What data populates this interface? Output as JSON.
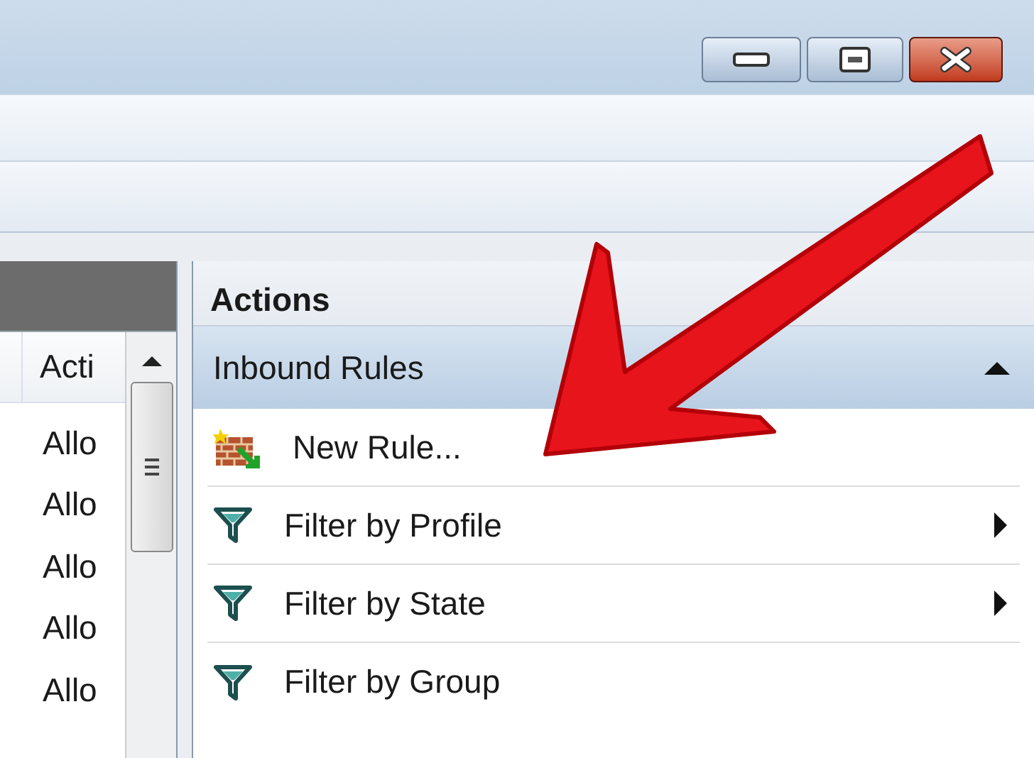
{
  "left_pane": {
    "columns": [
      {
        "label": "Acti"
      }
    ],
    "rows": [
      {
        "action": "Allo"
      },
      {
        "action": "Allo"
      },
      {
        "action": "Allo"
      },
      {
        "action": "Allo"
      },
      {
        "action": "Allo"
      }
    ]
  },
  "actions": {
    "title": "Actions",
    "section": {
      "title": "Inbound Rules",
      "expanded": true
    },
    "items": [
      {
        "kind": "new-rule",
        "label": "New Rule...",
        "submenu": false
      },
      {
        "kind": "filter",
        "label": "Filter by Profile",
        "submenu": true
      },
      {
        "kind": "filter",
        "label": "Filter by State",
        "submenu": true
      },
      {
        "kind": "filter",
        "label": "Filter by Group",
        "submenu": false
      }
    ]
  }
}
